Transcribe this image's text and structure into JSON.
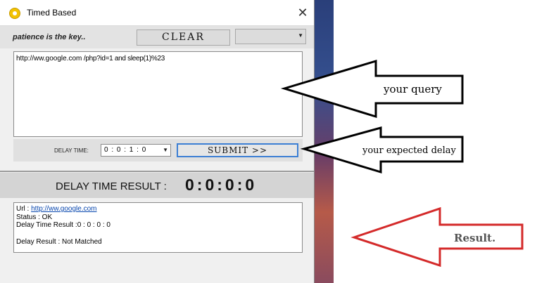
{
  "window": {
    "title": "Timed Based",
    "close_label": "✕"
  },
  "topbar": {
    "tagline": "patience is the key..",
    "clear_label": "CLEAR",
    "dropdown_value": ""
  },
  "query": {
    "url_text": "http://ww.google.com",
    "suffix_text": " /php?id=1 and sleep(1)%23"
  },
  "delay": {
    "label": "DELAY TIME:",
    "value": "0 : 0 : 1 : 0",
    "submit_label": "SUBMIT >>"
  },
  "result": {
    "label": "DELAY TIME RESULT :",
    "value": "0:0:0:0"
  },
  "output": {
    "url_label": "Url : ",
    "url_link": "http://ww.google.com",
    "status": "Status : OK",
    "delay_time_result": "Delay Time Result :0 : 0 : 0 : 0",
    "delay_result": "Delay Result : Not Matched"
  },
  "annotations": {
    "query_note": "your query",
    "delay_note": "your expected delay",
    "result_note": "Result."
  },
  "colors": {
    "submit_border": "#3c7fd4",
    "link": "#0645ad",
    "arrow_black": "#000000",
    "arrow_red": "#d42a2a"
  }
}
